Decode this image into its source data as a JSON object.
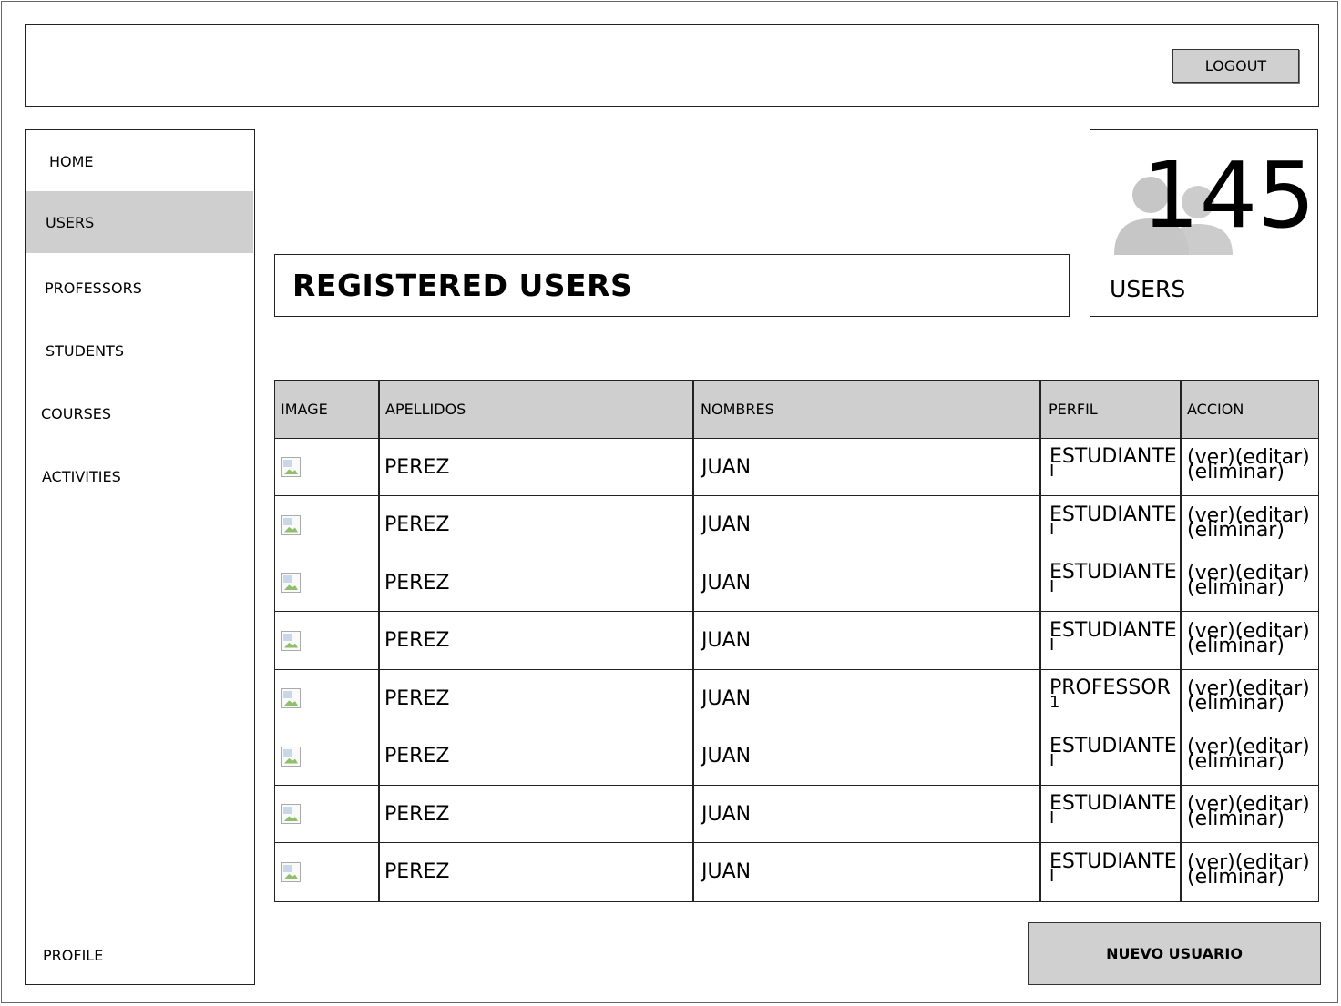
{
  "header": {
    "logout_label": "LOGOUT"
  },
  "sidebar": {
    "items": [
      {
        "label": "HOME"
      },
      {
        "label": "USERS"
      },
      {
        "label": "PROFESSORS"
      },
      {
        "label": "STUDENTS"
      },
      {
        "label": "COURSES"
      },
      {
        "label": "ACTIVITIES"
      }
    ],
    "profile_label": "PROFILE",
    "active": "USERS"
  },
  "main": {
    "title": "REGISTERED USERS",
    "counter": {
      "value": "145",
      "label": "USERS",
      "icon": "users-group-icon"
    },
    "table": {
      "columns": [
        "IMAGE",
        "APELLIDOS",
        "NOMBRES",
        "PERFIL",
        "ACCION"
      ],
      "rows": [
        {
          "apellidos": "PEREZ",
          "nombres": "JUAN",
          "perfil": "ESTUDIANTE",
          "perfil_sub": "I",
          "acciones": [
            "(ver)",
            "(editar)",
            "(eliminar)"
          ]
        },
        {
          "apellidos": "PEREZ",
          "nombres": "JUAN",
          "perfil": "ESTUDIANTE",
          "perfil_sub": "I",
          "acciones": [
            "(ver)",
            "(editar)",
            "(eliminar)"
          ]
        },
        {
          "apellidos": "PEREZ",
          "nombres": "JUAN",
          "perfil": "ESTUDIANTE",
          "perfil_sub": "I",
          "acciones": [
            "(ver)",
            "(editar)",
            "(eliminar)"
          ]
        },
        {
          "apellidos": "PEREZ",
          "nombres": "JUAN",
          "perfil": "ESTUDIANTE",
          "perfil_sub": "I",
          "acciones": [
            "(ver)",
            "(editar)",
            "(eliminar)"
          ]
        },
        {
          "apellidos": "PEREZ",
          "nombres": "JUAN",
          "perfil": "PROFESSOR",
          "perfil_sub": "1",
          "acciones": [
            "(ver)",
            "(editar)",
            "(eliminar)"
          ]
        },
        {
          "apellidos": "PEREZ",
          "nombres": "JUAN",
          "perfil": "ESTUDIANTE",
          "perfil_sub": "I",
          "acciones": [
            "(ver)",
            "(editar)",
            "(eliminar)"
          ]
        },
        {
          "apellidos": "PEREZ",
          "nombres": "JUAN",
          "perfil": "ESTUDIANTE",
          "perfil_sub": "I",
          "acciones": [
            "(ver)",
            "(editar)",
            "(eliminar)"
          ]
        },
        {
          "apellidos": "PEREZ",
          "nombres": "JUAN",
          "perfil": "ESTUDIANTE",
          "perfil_sub": "I",
          "acciones": [
            "(ver)",
            "(editar)",
            "(eliminar)"
          ]
        }
      ]
    },
    "new_user_label": "NUEVO USUARIO"
  },
  "colors": {
    "fill_gray": "#cfcfcf",
    "border": "#222222",
    "background": "#ffffff"
  }
}
